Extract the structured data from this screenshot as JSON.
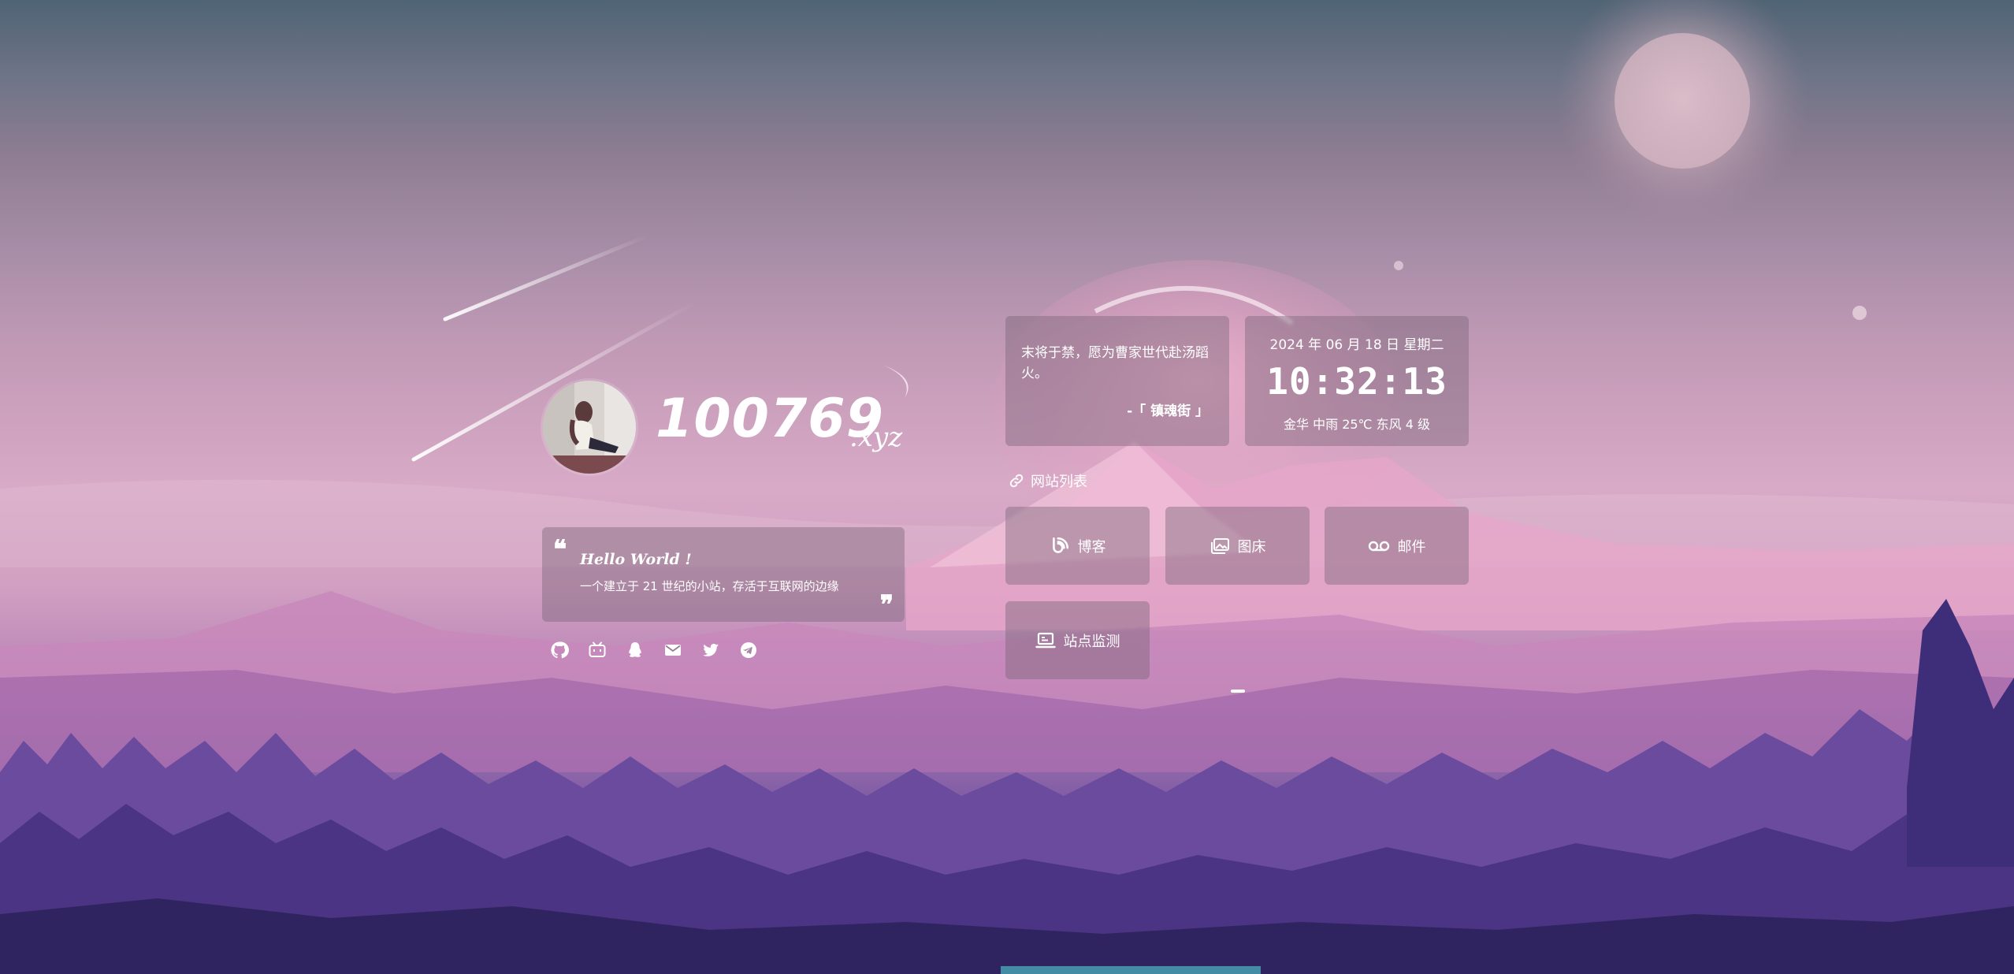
{
  "profile": {
    "site_name": "100769",
    "site_suffix": ".xyz",
    "avatar_icon": "avatar-photo-icon"
  },
  "intro": {
    "greeting": "Hello World !",
    "tagline": "一个建立于 21 世纪的小站，存活于互联网的边缘",
    "open_quote": "❝",
    "close_quote": "❞"
  },
  "socials": [
    {
      "name": "github-icon"
    },
    {
      "name": "bilibili-icon"
    },
    {
      "name": "qq-icon"
    },
    {
      "name": "email-icon"
    },
    {
      "name": "twitter-icon"
    },
    {
      "name": "telegram-icon"
    }
  ],
  "poem": {
    "text": "末将于禁，愿为曹家世代赴汤蹈火。",
    "author": "-「 镇魂街 」"
  },
  "clock": {
    "date": "2024 年 06 月 18 日 星期二",
    "time": "10:32:13",
    "weather": "金华  中雨 25℃  东风  4 级"
  },
  "links": {
    "title": "网站列表",
    "items": [
      {
        "label": "博客",
        "icon": "blog-icon"
      },
      {
        "label": "图床",
        "icon": "image-host-icon"
      },
      {
        "label": "邮件",
        "icon": "voicemail-icon"
      },
      {
        "label": "站点监测",
        "icon": "monitor-icon"
      }
    ]
  },
  "colors": {
    "card_bg": "rgba(120,100,120,0.42)",
    "text": "#ffffff"
  }
}
